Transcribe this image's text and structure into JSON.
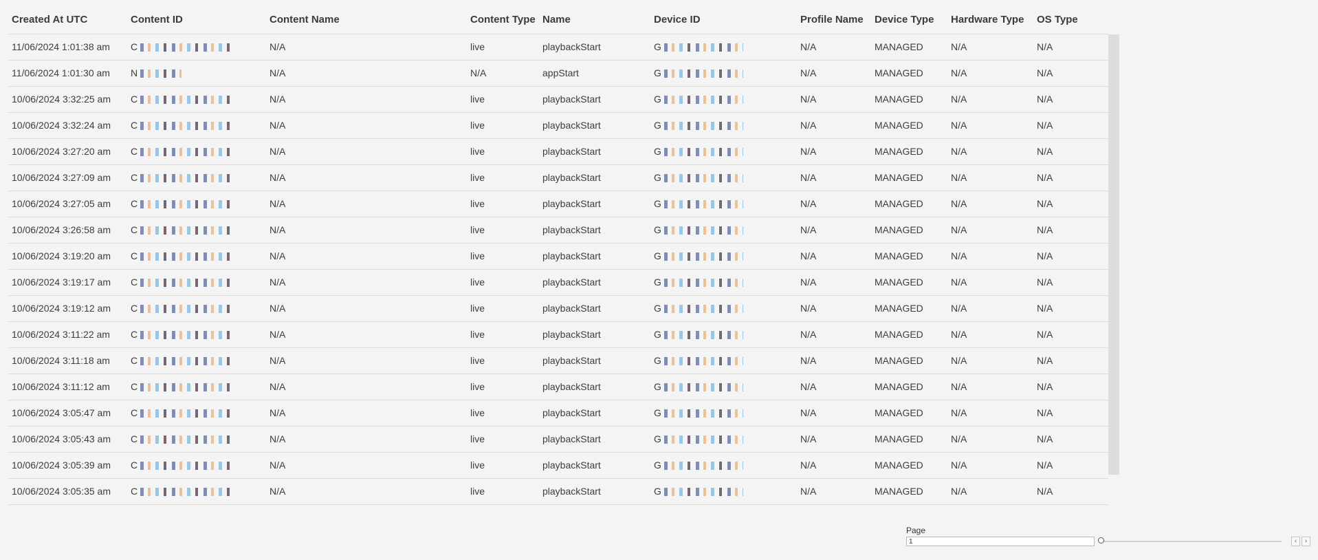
{
  "columns": [
    "Created At UTC",
    "Content ID",
    "Content Name",
    "Content Type",
    "Name",
    "Device ID",
    "Profile Name",
    "Device Type",
    "Hardware Type",
    "OS Type"
  ],
  "rows": [
    {
      "created": "11/06/2024 1:01:38 am",
      "content_id_prefix": "C",
      "content_name": "N/A",
      "content_type": "live",
      "name": "playbackStart",
      "device_id_prefix": "G",
      "profile": "N/A",
      "device_type": "MANAGED",
      "hardware": "N/A",
      "os": "N/A"
    },
    {
      "created": "11/06/2024 1:01:30 am",
      "content_id_prefix": "N",
      "content_name": "N/A",
      "content_type": "N/A",
      "name": "appStart",
      "device_id_prefix": "G",
      "profile": "N/A",
      "device_type": "MANAGED",
      "hardware": "N/A",
      "os": "N/A"
    },
    {
      "created": "10/06/2024 3:32:25 am",
      "content_id_prefix": "C",
      "content_name": "N/A",
      "content_type": "live",
      "name": "playbackStart",
      "device_id_prefix": "G",
      "profile": "N/A",
      "device_type": "MANAGED",
      "hardware": "N/A",
      "os": "N/A"
    },
    {
      "created": "10/06/2024 3:32:24 am",
      "content_id_prefix": "C",
      "content_name": "N/A",
      "content_type": "live",
      "name": "playbackStart",
      "device_id_prefix": "G",
      "profile": "N/A",
      "device_type": "MANAGED",
      "hardware": "N/A",
      "os": "N/A"
    },
    {
      "created": "10/06/2024 3:27:20 am",
      "content_id_prefix": "C",
      "content_name": "N/A",
      "content_type": "live",
      "name": "playbackStart",
      "device_id_prefix": "G",
      "profile": "N/A",
      "device_type": "MANAGED",
      "hardware": "N/A",
      "os": "N/A"
    },
    {
      "created": "10/06/2024 3:27:09 am",
      "content_id_prefix": "C",
      "content_name": "N/A",
      "content_type": "live",
      "name": "playbackStart",
      "device_id_prefix": "G",
      "profile": "N/A",
      "device_type": "MANAGED",
      "hardware": "N/A",
      "os": "N/A"
    },
    {
      "created": "10/06/2024 3:27:05 am",
      "content_id_prefix": "C",
      "content_name": "N/A",
      "content_type": "live",
      "name": "playbackStart",
      "device_id_prefix": "G",
      "profile": "N/A",
      "device_type": "MANAGED",
      "hardware": "N/A",
      "os": "N/A"
    },
    {
      "created": "10/06/2024 3:26:58 am",
      "content_id_prefix": "C",
      "content_name": "N/A",
      "content_type": "live",
      "name": "playbackStart",
      "device_id_prefix": "G",
      "profile": "N/A",
      "device_type": "MANAGED",
      "hardware": "N/A",
      "os": "N/A"
    },
    {
      "created": "10/06/2024 3:19:20 am",
      "content_id_prefix": "C",
      "content_name": "N/A",
      "content_type": "live",
      "name": "playbackStart",
      "device_id_prefix": "G",
      "profile": "N/A",
      "device_type": "MANAGED",
      "hardware": "N/A",
      "os": "N/A"
    },
    {
      "created": "10/06/2024 3:19:17 am",
      "content_id_prefix": "C",
      "content_name": "N/A",
      "content_type": "live",
      "name": "playbackStart",
      "device_id_prefix": "G",
      "profile": "N/A",
      "device_type": "MANAGED",
      "hardware": "N/A",
      "os": "N/A"
    },
    {
      "created": "10/06/2024 3:19:12 am",
      "content_id_prefix": "C",
      "content_name": "N/A",
      "content_type": "live",
      "name": "playbackStart",
      "device_id_prefix": "G",
      "profile": "N/A",
      "device_type": "MANAGED",
      "hardware": "N/A",
      "os": "N/A"
    },
    {
      "created": "10/06/2024 3:11:22 am",
      "content_id_prefix": "C",
      "content_name": "N/A",
      "content_type": "live",
      "name": "playbackStart",
      "device_id_prefix": "G",
      "profile": "N/A",
      "device_type": "MANAGED",
      "hardware": "N/A",
      "os": "N/A"
    },
    {
      "created": "10/06/2024 3:11:18 am",
      "content_id_prefix": "C",
      "content_name": "N/A",
      "content_type": "live",
      "name": "playbackStart",
      "device_id_prefix": "G",
      "profile": "N/A",
      "device_type": "MANAGED",
      "hardware": "N/A",
      "os": "N/A"
    },
    {
      "created": "10/06/2024 3:11:12 am",
      "content_id_prefix": "C",
      "content_name": "N/A",
      "content_type": "live",
      "name": "playbackStart",
      "device_id_prefix": "G",
      "profile": "N/A",
      "device_type": "MANAGED",
      "hardware": "N/A",
      "os": "N/A"
    },
    {
      "created": "10/06/2024 3:05:47 am",
      "content_id_prefix": "C",
      "content_name": "N/A",
      "content_type": "live",
      "name": "playbackStart",
      "device_id_prefix": "G",
      "profile": "N/A",
      "device_type": "MANAGED",
      "hardware": "N/A",
      "os": "N/A"
    },
    {
      "created": "10/06/2024 3:05:43 am",
      "content_id_prefix": "C",
      "content_name": "N/A",
      "content_type": "live",
      "name": "playbackStart",
      "device_id_prefix": "G",
      "profile": "N/A",
      "device_type": "MANAGED",
      "hardware": "N/A",
      "os": "N/A"
    },
    {
      "created": "10/06/2024 3:05:39 am",
      "content_id_prefix": "C",
      "content_name": "N/A",
      "content_type": "live",
      "name": "playbackStart",
      "device_id_prefix": "G",
      "profile": "N/A",
      "device_type": "MANAGED",
      "hardware": "N/A",
      "os": "N/A"
    },
    {
      "created": "10/06/2024 3:05:35 am",
      "content_id_prefix": "C",
      "content_name": "N/A",
      "content_type": "live",
      "name": "playbackStart",
      "device_id_prefix": "G",
      "profile": "N/A",
      "device_type": "MANAGED",
      "hardware": "N/A",
      "os": "N/A"
    }
  ],
  "pager": {
    "label": "Page",
    "value": "1",
    "prev_icon": "chevron-left-icon",
    "next_icon": "chevron-right-icon",
    "prev_glyph": "‹",
    "next_glyph": "›"
  }
}
